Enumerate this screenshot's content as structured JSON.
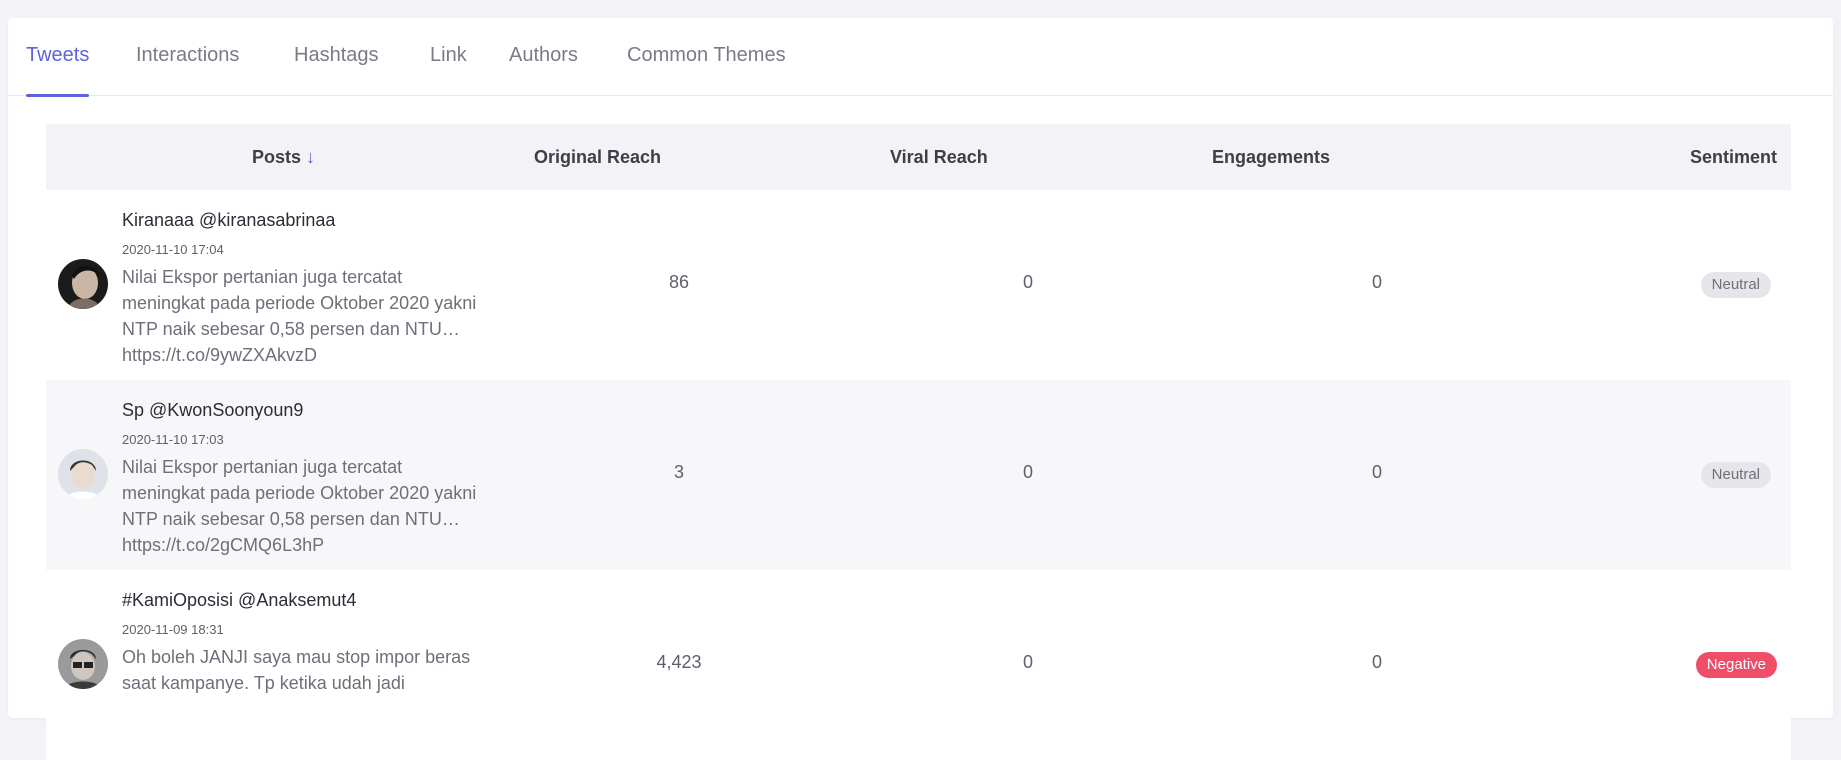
{
  "tabs": [
    {
      "label": "Tweets",
      "active": true
    },
    {
      "label": "Interactions",
      "active": false
    },
    {
      "label": "Hashtags",
      "active": false
    },
    {
      "label": "Link",
      "active": false
    },
    {
      "label": "Authors",
      "active": false
    },
    {
      "label": "Common Themes",
      "active": false
    }
  ],
  "table": {
    "headers": {
      "posts": "Posts",
      "original_reach": "Original Reach",
      "viral_reach": "Viral Reach",
      "engagements": "Engagements",
      "sentiment": "Sentiment"
    },
    "sort_icon": "arrow-down-icon",
    "rows": [
      {
        "author": "Kiranaaa @kiranasabrinaa",
        "timestamp": "2020-11-10 17:04",
        "text": "Nilai Ekspor pertanian juga tercatat meningkat pada periode Oktober 2020 yakni NTP naik sebesar 0,58 persen dan NTU… https://t.co/9ywZXAkvzD",
        "original_reach": "86",
        "viral_reach": "0",
        "engagements": "0",
        "sentiment": "Neutral"
      },
      {
        "author": "Sp @KwonSoonyoun9",
        "timestamp": "2020-11-10 17:03",
        "text": "Nilai Ekspor pertanian juga tercatat meningkat pada periode Oktober 2020 yakni NTP naik sebesar 0,58 persen dan NTU… https://t.co/2gCMQ6L3hP",
        "original_reach": "3",
        "viral_reach": "0",
        "engagements": "0",
        "sentiment": "Neutral"
      },
      {
        "author": "#KamiOposisi @Anaksemut4",
        "timestamp": "2020-11-09 18:31",
        "text": "Oh boleh JANJI saya mau stop impor beras saat kampanye. Tp ketika udah jadi",
        "original_reach": "4,423",
        "viral_reach": "0",
        "engagements": "0",
        "sentiment": "Negative"
      }
    ]
  },
  "colors": {
    "accent": "#5d63da",
    "neutral_badge": "#e6e6ea",
    "negative_badge": "#ef4e69",
    "header_bg": "#f3f3f7"
  }
}
